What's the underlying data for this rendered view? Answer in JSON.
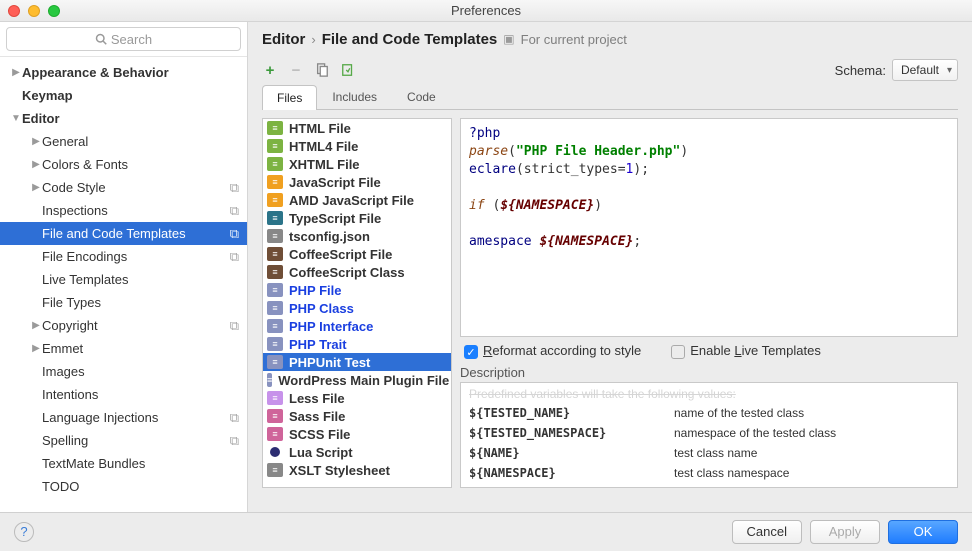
{
  "window_title": "Preferences",
  "search_placeholder": "Search",
  "sidebar": [
    {
      "label": "Appearance & Behavior",
      "ind": 0,
      "chev": "▶",
      "bold": true
    },
    {
      "label": "Keymap",
      "ind": 0,
      "bold": true
    },
    {
      "label": "Editor",
      "ind": 0,
      "chev": "▼",
      "bold": true,
      "expanded": true
    },
    {
      "label": "General",
      "ind": 1,
      "chev": "▶"
    },
    {
      "label": "Colors & Fonts",
      "ind": 1,
      "chev": "▶"
    },
    {
      "label": "Code Style",
      "ind": 1,
      "chev": "▶",
      "copy": true
    },
    {
      "label": "Inspections",
      "ind": 1,
      "copy": true
    },
    {
      "label": "File and Code Templates",
      "ind": 1,
      "copy": true,
      "selected": true
    },
    {
      "label": "File Encodings",
      "ind": 1,
      "copy": true
    },
    {
      "label": "Live Templates",
      "ind": 1
    },
    {
      "label": "File Types",
      "ind": 1
    },
    {
      "label": "Copyright",
      "ind": 1,
      "chev": "▶",
      "copy": true
    },
    {
      "label": "Emmet",
      "ind": 1,
      "chev": "▶"
    },
    {
      "label": "Images",
      "ind": 1
    },
    {
      "label": "Intentions",
      "ind": 1
    },
    {
      "label": "Language Injections",
      "ind": 1,
      "copy": true
    },
    {
      "label": "Spelling",
      "ind": 1,
      "copy": true
    },
    {
      "label": "TextMate Bundles",
      "ind": 1
    },
    {
      "label": "TODO",
      "ind": 1
    }
  ],
  "breadcrumb": {
    "a": "Editor",
    "b": "File and Code Templates",
    "proj": "For current project"
  },
  "schema_label": "Schema:",
  "schema_value": "Default",
  "tabs": [
    "Files",
    "Includes",
    "Code"
  ],
  "active_tab": 0,
  "templates": [
    {
      "label": "HTML File",
      "ico": "#7cb342"
    },
    {
      "label": "HTML4 File",
      "ico": "#7cb342"
    },
    {
      "label": "XHTML File",
      "ico": "#7cb342"
    },
    {
      "label": "JavaScript File",
      "ico": "#f0a020"
    },
    {
      "label": "AMD JavaScript File",
      "ico": "#f0a020"
    },
    {
      "label": "TypeScript File",
      "ico": "#2b7489"
    },
    {
      "label": "tsconfig.json",
      "ico": "#888"
    },
    {
      "label": "CoffeeScript File",
      "ico": "#6f4e37"
    },
    {
      "label": "CoffeeScript Class",
      "ico": "#6f4e37"
    },
    {
      "label": "PHP File",
      "ico": "#8892bf",
      "phpblue": true
    },
    {
      "label": "PHP Class",
      "ico": "#8892bf",
      "phpblue": true
    },
    {
      "label": "PHP Interface",
      "ico": "#8892bf",
      "phpblue": true
    },
    {
      "label": "PHP Trait",
      "ico": "#8892bf",
      "phpblue": true
    },
    {
      "label": "PHPUnit Test",
      "ico": "#8892bf",
      "selected": true,
      "phpblue": true
    },
    {
      "label": "WordPress Main Plugin File",
      "ico": "#8892bf"
    },
    {
      "label": "Less File",
      "ico": "#c792ea"
    },
    {
      "label": "Sass File",
      "ico": "#cf649a"
    },
    {
      "label": "SCSS File",
      "ico": "#cf649a"
    },
    {
      "label": "Lua Script",
      "ico": "#2c2d72",
      "dot": true
    },
    {
      "label": "XSLT Stylesheet",
      "ico": "#888"
    }
  ],
  "code_lines": [
    "?php",
    "parse(\"PHP File Header.php\")",
    "eclare(strict_types=1);",
    "",
    "if (${NAMESPACE})",
    "",
    "amespace ${NAMESPACE};"
  ],
  "opt_reformat": "Reformat according to style",
  "opt_live": "Enable Live Templates",
  "reformat_checked": true,
  "live_checked": false,
  "desc_label": "Description",
  "desc_strike": "Predefined variables will take the following values:",
  "vars": [
    {
      "name": "${TESTED_NAME}",
      "desc": "name of the tested class"
    },
    {
      "name": "${TESTED_NAMESPACE}",
      "desc": "namespace of the tested class"
    },
    {
      "name": "${NAME}",
      "desc": "test class name"
    },
    {
      "name": "${NAMESPACE}",
      "desc": "test class namespace"
    }
  ],
  "buttons": {
    "cancel": "Cancel",
    "apply": "Apply",
    "ok": "OK"
  }
}
